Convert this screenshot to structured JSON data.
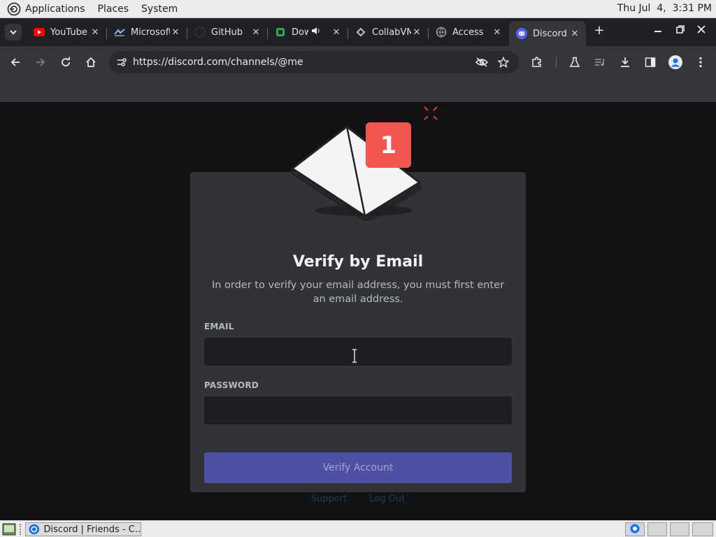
{
  "top_panel": {
    "menus": [
      "Applications",
      "Places",
      "System"
    ],
    "clock": "Thu Jul  4,  3:31 PM"
  },
  "tabs": [
    {
      "title": "YouTube",
      "icon": "youtube-icon",
      "active": false
    },
    {
      "title": "Microsoft",
      "icon": "microsoft-icon",
      "active": false
    },
    {
      "title": "GitHub",
      "icon": "github-icon",
      "active": false
    },
    {
      "title": "Dow",
      "icon": "download-app-icon",
      "active": false
    },
    {
      "title": "CollabVM",
      "icon": "collabvm-icon",
      "active": false
    },
    {
      "title": "Access",
      "icon": "globe-icon",
      "active": false
    },
    {
      "title": "Discord",
      "icon": "discord-icon",
      "active": true
    }
  ],
  "toolbar": {
    "url": "https://discord.com/channels/@me"
  },
  "card": {
    "badge_count": "1",
    "title": "Verify by Email",
    "description": "In order to verify your email address, you must first enter an email address.",
    "email_label": "EMAIL",
    "email_value": "",
    "password_label": "PASSWORD",
    "password_value": "",
    "verify_button": "Verify Account"
  },
  "footer_links": {
    "support": "Support",
    "logout": "Log Out"
  },
  "taskbar": {
    "window_title": "Discord | Friends - C..."
  },
  "colors": {
    "accent": "#5865f2",
    "badge": "#f2544f",
    "card_bg": "#313338"
  }
}
